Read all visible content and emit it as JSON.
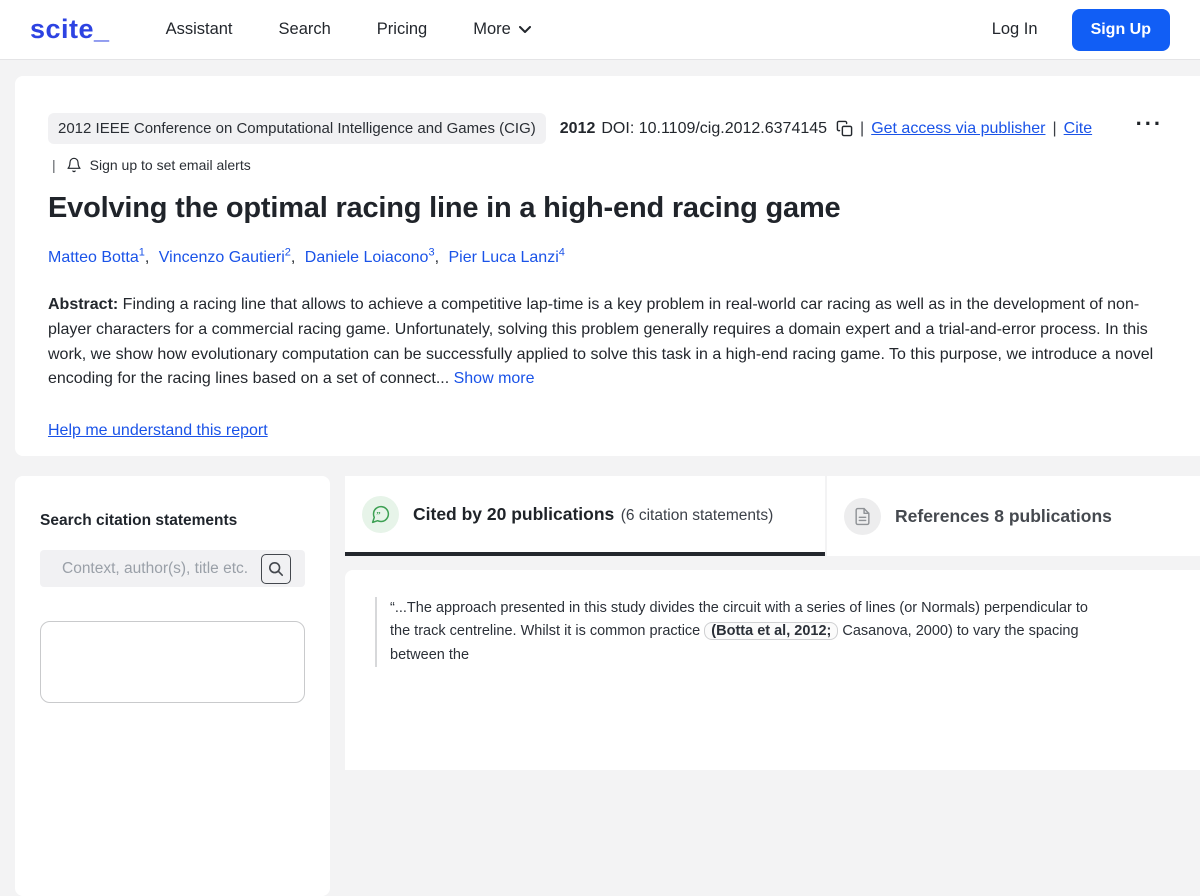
{
  "colors": {
    "brand_blue": "#2d43e2",
    "accent_blue": "#115ef5",
    "link_blue": "#1a53e8",
    "active_tab_underline": "#23272d",
    "cited_green": "#3da053",
    "page_background": "#f3f3f4"
  },
  "header": {
    "logo": "scite_",
    "nav": [
      {
        "label": "Assistant"
      },
      {
        "label": "Search"
      },
      {
        "label": "Pricing"
      },
      {
        "label": "More"
      }
    ],
    "login_label": "Log In",
    "signup_label": "Sign Up"
  },
  "paper": {
    "venue_badge": "2012 IEEE Conference on Computational Intelligence and Games (CIG)",
    "year": "2012",
    "doi": "DOI: 10.1109/cig.2012.6374145",
    "pipe": "|",
    "get_access_label": "Get access via publisher",
    "cite_label": "Cite",
    "overflow_label": "...",
    "email_alerts_label": "Sign up to set email alerts",
    "title": "Evolving the optimal racing line in a high-end racing game",
    "author_separator": ",",
    "authors": [
      {
        "name": "Matteo Botta",
        "sup": "1"
      },
      {
        "name": "Vincenzo Gautieri",
        "sup": "2"
      },
      {
        "name": "Daniele Loiacono",
        "sup": "3"
      },
      {
        "name": "Pier Luca Lanzi",
        "sup": "4"
      }
    ],
    "abstract_label": "Abstract:",
    "abstract_text": " Finding a racing line that allows to achieve a competitive lap-time is a key problem in real-world car racing as well as in the development of non-player characters for a commercial racing game. Unfortunately, solving this problem generally requires a domain expert and a trial-and-error process. In this work, we show how evolutionary computation can be successfully applied to solve this task in a high-end racing game. To this purpose, we introduce a novel encoding for the racing lines based on a set of connect... ",
    "show_more_label": "Show more",
    "help_link_label": "Help me understand this report"
  },
  "sidebar": {
    "search_heading": "Search citation statements",
    "search_placeholder": "Context, author(s), title etc."
  },
  "tabs": {
    "cited": {
      "label": "Cited by 20 publications",
      "sub": "(6 citation statements)"
    },
    "references": {
      "label": "References 8 publications"
    }
  },
  "citation": {
    "quote_part1": "“...The approach presented in this study divides the circuit with a series of lines (or Normals) perpendicular to the track centreline. Whilst it is common practice ",
    "citation_pill": "(Botta et al, 2012;",
    "quote_part2": " Casanova, 2000) to vary the spacing between the"
  }
}
